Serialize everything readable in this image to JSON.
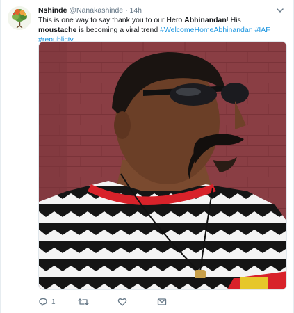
{
  "author": {
    "name": "Nshinde",
    "handle": "@Nanakashinde",
    "time": "14h",
    "separator": "·"
  },
  "tweet": {
    "segments": [
      {
        "text": "This is one way to say thank you to our Hero ",
        "style": "plain"
      },
      {
        "text": "Abhinandan",
        "style": "bold"
      },
      {
        "text": "! His ",
        "style": "plain"
      },
      {
        "text": "moustache",
        "style": "bold"
      },
      {
        "text": " is becoming a viral trend ",
        "style": "plain"
      },
      {
        "text": "#WelcomeHomeAbhinandan",
        "style": "link"
      },
      {
        "text": " ",
        "style": "plain"
      },
      {
        "text": "#IAF",
        "style": "link"
      },
      {
        "text": " ",
        "style": "plain"
      },
      {
        "text": "#republictv",
        "style": "link"
      }
    ]
  },
  "actions": {
    "reply_count": "1",
    "retweet_count": "",
    "like_count": ""
  },
  "colors": {
    "link": "#1b95e0",
    "muted": "#657786",
    "text": "#14171a"
  }
}
